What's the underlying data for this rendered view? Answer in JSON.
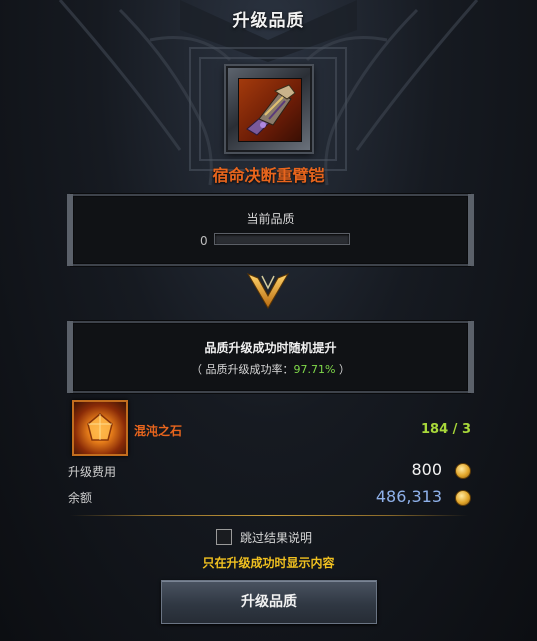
{
  "window": {
    "title": "升级品质"
  },
  "item": {
    "name": "宿命决断重臂铠",
    "icon": "gauntlet-icon"
  },
  "current_quality": {
    "label": "当前品质",
    "value": "0",
    "progress": 0
  },
  "upgrade_info": {
    "title": "品质升级成功时随机提升",
    "rate_prefix": "（ 品质升级成功率：",
    "rate_value": "97.71%",
    "rate_suffix": " ）"
  },
  "material": {
    "name": "混沌之石",
    "count": "184 / 3",
    "icon": "chaos-stone-icon"
  },
  "cost": {
    "label": "升级费用",
    "value": "800",
    "icon": "gold-coin-icon"
  },
  "balance": {
    "label": "余额",
    "value": "486,313",
    "icon": "gold-coin-icon"
  },
  "skip": {
    "label": "跳过结果说明",
    "checked": false
  },
  "hint": "只在升级成功时显示内容",
  "button": {
    "label": "升级品质"
  },
  "colors": {
    "item_name": "#e8651d",
    "success_rate": "#7fd84a",
    "material_count": "#a8d83a",
    "balance": "#8fb1ea",
    "hint": "#f0c020"
  }
}
